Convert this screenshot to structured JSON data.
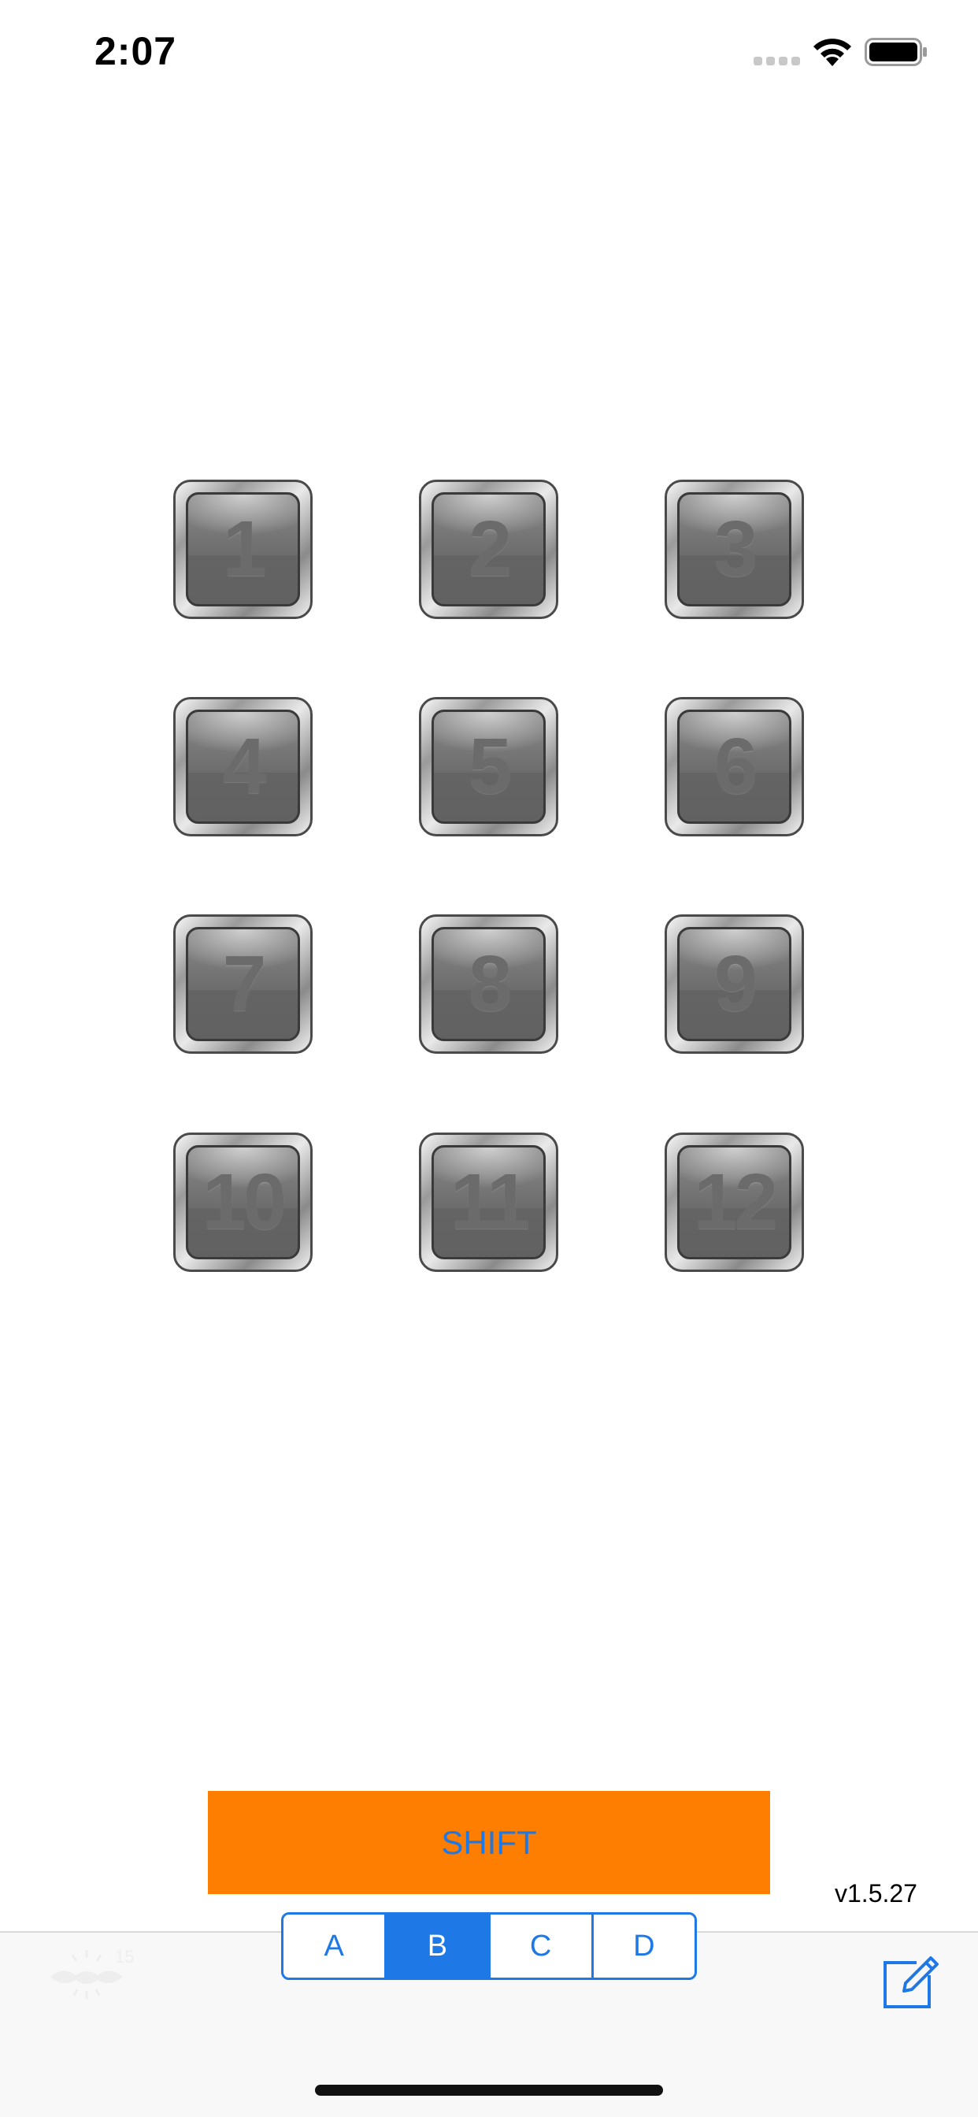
{
  "status_bar": {
    "time": "2:07"
  },
  "keypad": {
    "keys": [
      "1",
      "2",
      "3",
      "4",
      "5",
      "6",
      "7",
      "8",
      "9",
      "10",
      "11",
      "12"
    ]
  },
  "shift": {
    "label": "SHIFT"
  },
  "version": "v1.5.27",
  "segmented_control": {
    "options": [
      "A",
      "B",
      "C",
      "D"
    ],
    "selected": "B"
  },
  "colors": {
    "accent": "#1e78e6",
    "shift_background": "#fd7e00",
    "key_face": "#6d6d6d"
  },
  "icons": {
    "status": [
      "signal-icon",
      "wifi-icon",
      "battery-icon"
    ],
    "toolbar": [
      "weather-icon",
      "compose-icon"
    ]
  }
}
